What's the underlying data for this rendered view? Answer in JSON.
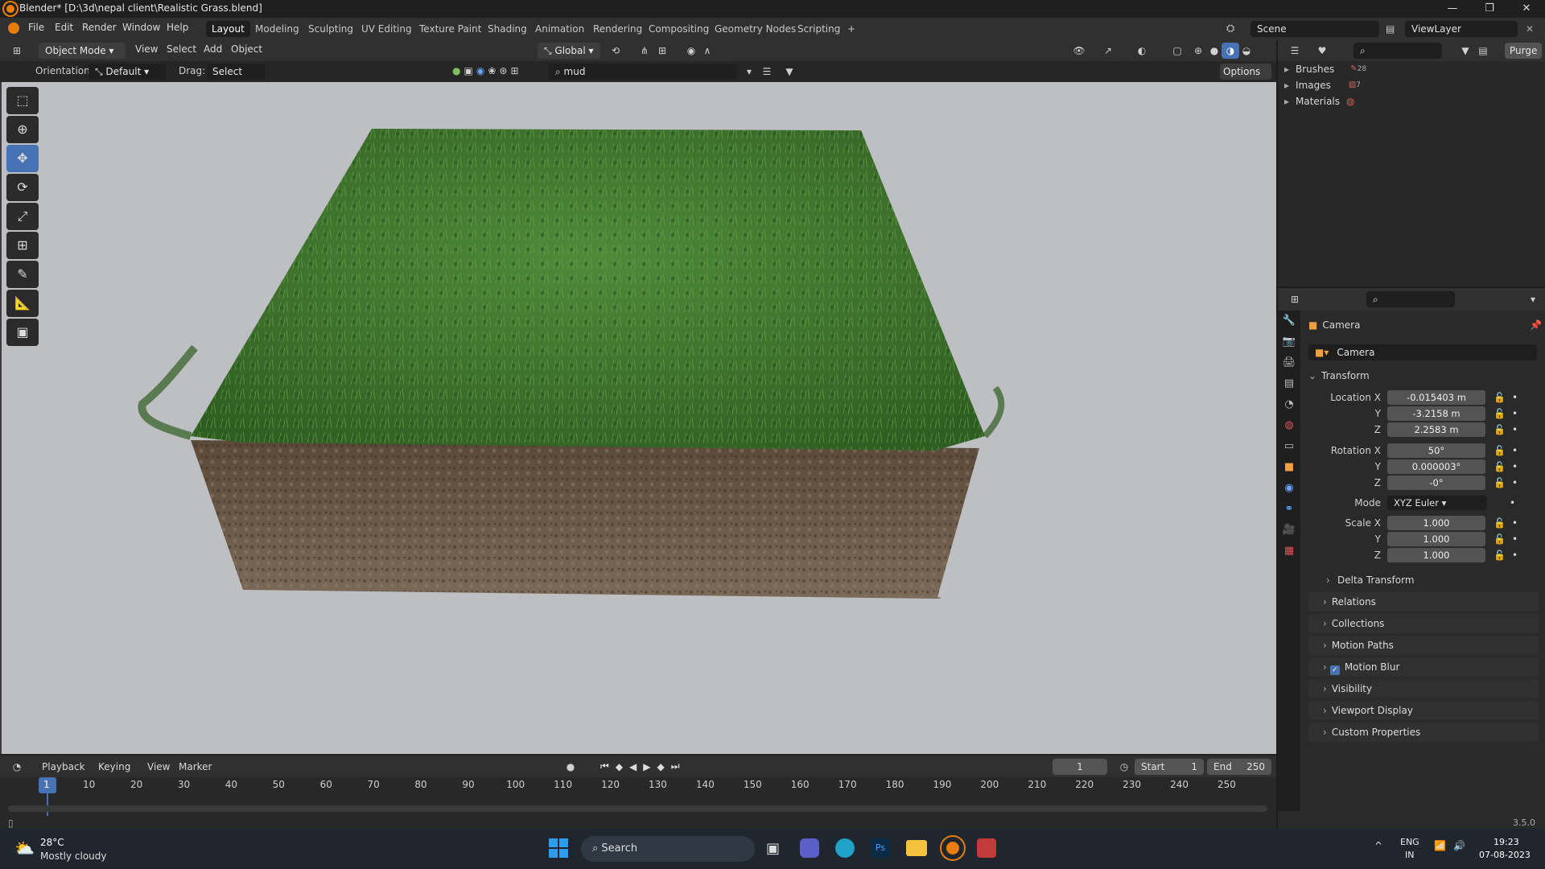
{
  "window": {
    "title": "Blender* [D:\\3d\\nepal client\\Realistic Grass.blend]",
    "min": "—",
    "max": "❐",
    "close": "✕"
  },
  "menus": [
    "File",
    "Edit",
    "Render",
    "Window",
    "Help"
  ],
  "workspaces": [
    "Layout",
    "Modeling",
    "Sculpting",
    "UV Editing",
    "Texture Paint",
    "Shading",
    "Animation",
    "Rendering",
    "Compositing",
    "Geometry Nodes",
    "Scripting",
    "+"
  ],
  "active_workspace": "Layout",
  "scene": "Scene",
  "view_layer": "ViewLayer",
  "viewport_header": {
    "mode": "Object Mode",
    "menus": [
      "View",
      "Select",
      "Add",
      "Object"
    ],
    "transform": "Global",
    "orientation_label": "Orientation:",
    "orientation_value": "Default",
    "drag_label": "Drag:",
    "drag_value": "Select Box",
    "search_value": "mud",
    "options": "Options"
  },
  "outliner": {
    "purge": "Purge",
    "items": [
      {
        "label": "Brushes",
        "count": "28"
      },
      {
        "label": "Images",
        "count": "7"
      },
      {
        "label": "Materials",
        "count": ""
      }
    ]
  },
  "properties": {
    "object_name": "Camera",
    "data_name": "Camera",
    "transform_label": "Transform",
    "location_label": "Location X",
    "rotation_label": "Rotation X",
    "scale_label": "Scale X",
    "y": "Y",
    "z": "Z",
    "location": [
      "-0.015403 m",
      "-3.2158 m",
      "2.2583 m"
    ],
    "rotation": [
      "50°",
      "0.000003°",
      "-0°"
    ],
    "mode_label": "Mode",
    "mode_value": "XYZ Euler",
    "scale": [
      "1.000",
      "1.000",
      "1.000"
    ],
    "delta": "Delta Transform",
    "panels": [
      "Relations",
      "Collections",
      "Motion Paths",
      "Motion Blur",
      "Visibility",
      "Viewport Display",
      "Custom Properties"
    ],
    "motion_blur_checked": true
  },
  "timeline": {
    "menus": [
      "Playback",
      "Keying",
      "View",
      "Marker"
    ],
    "current_frame": "1",
    "start_label": "Start",
    "start": "1",
    "end_label": "End",
    "end": "250",
    "ticks": [
      "1",
      "10",
      "20",
      "30",
      "40",
      "50",
      "60",
      "70",
      "80",
      "90",
      "100",
      "110",
      "120",
      "130",
      "140",
      "150",
      "160",
      "170",
      "180",
      "190",
      "200",
      "210",
      "220",
      "230",
      "240",
      "250"
    ],
    "version": "3.5.0"
  },
  "taskbar": {
    "temp": "28°C",
    "weather": "Mostly cloudy",
    "search": "Search",
    "lang1": "ENG",
    "lang2": "IN",
    "time": "19:23",
    "date": "07-08-2023"
  },
  "colors": {
    "accent": "#4772b3",
    "grass": "#3f7a2c",
    "soil": "#6e5c4c",
    "blender_orange": "#e87d0d"
  }
}
